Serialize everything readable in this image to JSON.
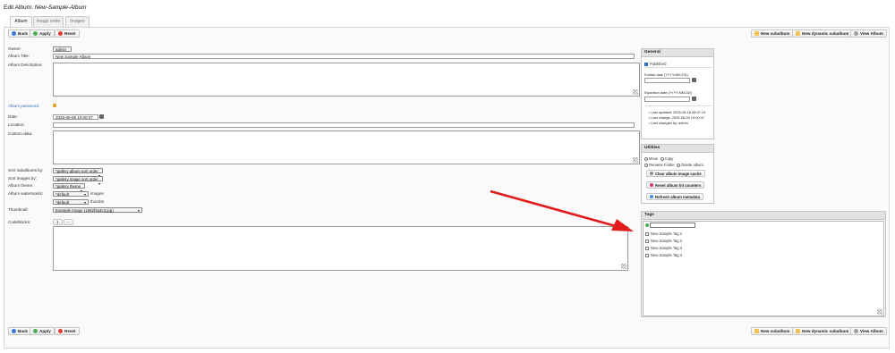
{
  "page": {
    "title_prefix": "Edit Album:",
    "title_name": "New-Sample-Album"
  },
  "tabs": [
    {
      "label": "Album"
    },
    {
      "label": "Image order"
    },
    {
      "label": "Images"
    }
  ],
  "toolbar": {
    "back": "Back",
    "apply": "Apply",
    "reset": "Reset",
    "new_subalbum": "New subalbum",
    "new_dynamic_subalbum": "New dynamic subalbum",
    "view_album": "View Album"
  },
  "form": {
    "owner_label": "Owner:",
    "owner_value": "admin",
    "title_label": "Album Title:",
    "title_value": "New Sample Album",
    "description_label": "Album Description:",
    "password_label": "Album password:",
    "date_label": "Date:",
    "date_value": "2025-06-09 10:00:47",
    "location_label": "Location:",
    "custom_label": "Custom data:",
    "sort_subalbums_label": "Sort subalbums by:",
    "sort_subalbums_value": "*gallery album sort order",
    "sort_images_label": "Sort images by:",
    "sort_images_value": "*gallery image sort order",
    "theme_label": "Album theme:",
    "theme_value": "*gallery theme",
    "watermarks_label": "Album watermarks:",
    "watermark_images_value": "*default",
    "watermark_images_suffix": "images",
    "watermark_thumbs_value": "*default",
    "watermark_thumbs_suffix": "thumbs",
    "thumbnail_label": "Thumbnail:",
    "thumbnail_value": "Example Image (1862f3a3c3.jpg)",
    "codeblocks_label": "Codeblocks:",
    "codeblock_tab1": "1",
    "codeblock_tab_add": "+"
  },
  "general": {
    "title": "General",
    "published_label": "Published",
    "publish_date_label": "Publish date (YYYY-MM-DD)",
    "expiration_date_label": "Expiration date (YYYY-MM-DD)",
    "info": [
      "Last updated: 2025-06-16 08:47:14",
      "Last change: 2025-06-09 10:00:47",
      "Last changed by: admin"
    ]
  },
  "utilities": {
    "title": "Utilities",
    "move": "Move",
    "copy": "Copy",
    "rename": "Rename Folder",
    "delete": "Delete album",
    "clear_cache": "Clear album image cache",
    "reset_counters": "Reset album hit counters",
    "refresh_metadata": "Refresh album metadata"
  },
  "tags": {
    "title": "Tags",
    "items": [
      "New Sample Tag 1",
      "New Sample Tag 2",
      "New Sample Tag 3",
      "New Sample Tag 4"
    ]
  },
  "colors": {
    "arrow": "#e21b1b",
    "link": "#3a6fb5"
  }
}
